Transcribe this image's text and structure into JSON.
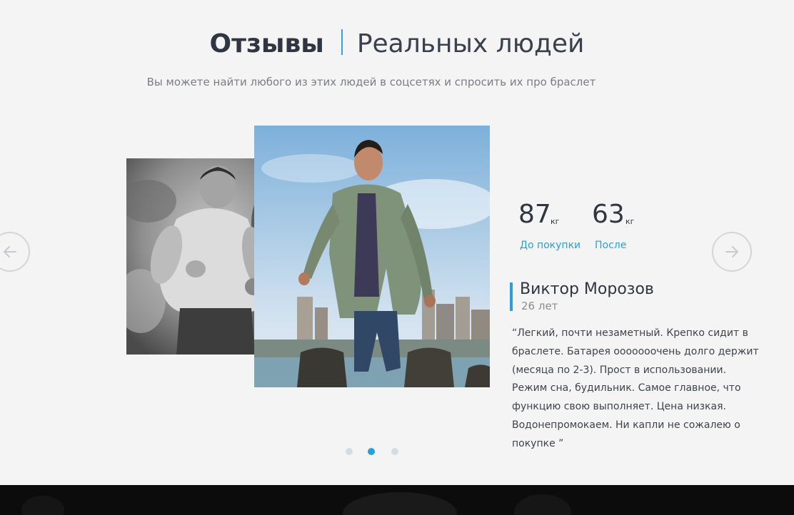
{
  "header": {
    "title_bold": "Отзывы",
    "title_light": "Реальных людей",
    "subtitle": "Вы можете найти любого из этих людей в соцсетях и спросить их  про браслет"
  },
  "testimonial": {
    "before": {
      "value": "87",
      "unit": "кг",
      "label": "До покупки"
    },
    "after": {
      "value": "63",
      "unit": "кг",
      "label": "После"
    },
    "name": "Виктор Морозов",
    "age": "26 лет",
    "quote": "“Легкий, почти незаметный. Крепко сидит в браслете. Батарея ооооооочень долго держит (месяца по 2-3). Прост в использовании. Режим сна, будильник. Самое главное, что функцию свою выполняет. Цена низкая.  Водонепромокаем. Ни капли не сожалею о покупке ”"
  },
  "carousel": {
    "prev_icon": "arrow-left-icon",
    "next_icon": "arrow-right-icon",
    "dots": 3,
    "active_index": 1
  },
  "colors": {
    "accent": "#2aa0d8",
    "background": "#f4f4f4",
    "heading": "#2f3541",
    "muted": "#7a7d82",
    "arrow_border": "#d2d6d9",
    "dot_inactive": "#d4dde2",
    "footer_strip": "#0c0c0c"
  }
}
